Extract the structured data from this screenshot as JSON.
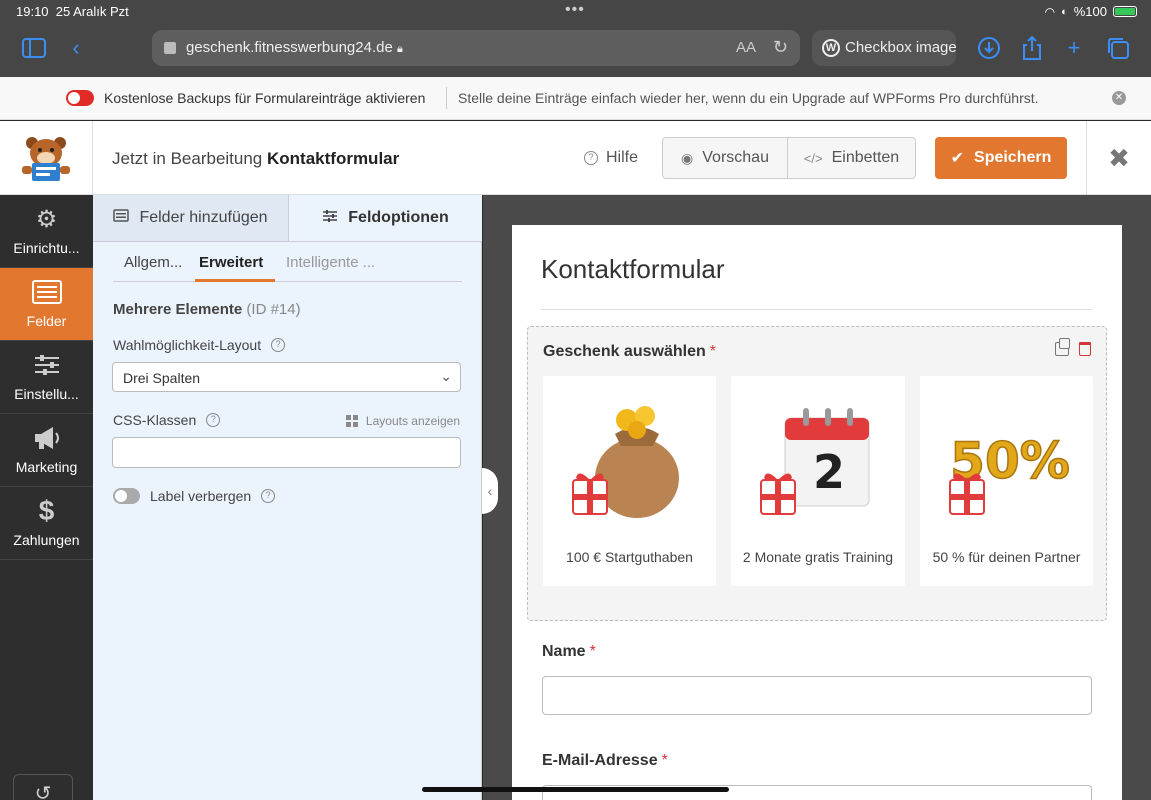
{
  "status": {
    "time": "19:10",
    "date": "25 Aralık Pzt",
    "battery": "%100"
  },
  "browser": {
    "url": "geschenk.fitnesswerbung24.de",
    "text_size": "AA",
    "other_tab": "Checkbox images"
  },
  "notice": {
    "toggle_label": "Kostenlose Backups für Formulareinträge aktivieren",
    "message": "Stelle deine Einträge einfach wieder her, wenn du ein Upgrade auf WPForms Pro durchführst."
  },
  "header": {
    "editing_prefix": "Jetzt in Bearbeitung",
    "form_name": "Kontaktformular",
    "help": "Hilfe",
    "preview": "Vorschau",
    "embed": "Einbetten",
    "save": "Speichern"
  },
  "nav": [
    {
      "label": "Einrichtu...",
      "icon": "gear-icon"
    },
    {
      "label": "Felder",
      "icon": "list-icon"
    },
    {
      "label": "Einstellu...",
      "icon": "sliders-icon"
    },
    {
      "label": "Marketing",
      "icon": "megaphone-icon"
    },
    {
      "label": "Zahlungen",
      "icon": "dollar-icon"
    }
  ],
  "panel": {
    "tab_add": "Felder hinzufügen",
    "tab_options": "Feldoptionen",
    "subtabs": [
      "Allgem...",
      "Erweitert",
      "Intelligente ..."
    ],
    "field_title": "Mehrere Elemente",
    "field_id": "(ID #14)",
    "layout_label": "Wahlmöglichkeit-Layout",
    "layout_value": "Drei Spalten",
    "css_label": "CSS-Klassen",
    "layouts_link": "Layouts anzeigen",
    "css_value": "",
    "hide_label": "Label verbergen"
  },
  "form": {
    "title": "Kontaktformular",
    "gift_label": "Geschenk auswählen",
    "required": "*",
    "choices": [
      {
        "caption": "100 € Startguthaben"
      },
      {
        "caption": "2 Monate gratis Training"
      },
      {
        "caption": "50 % für deinen Partner"
      }
    ],
    "calendar_number": "2",
    "percent_text": "50%",
    "name_label": "Name",
    "email_label": "E-Mail-Adresse"
  },
  "colors": {
    "accent": "#e27730",
    "required": "#d63638",
    "panel_bg": "#ebf3fc"
  }
}
